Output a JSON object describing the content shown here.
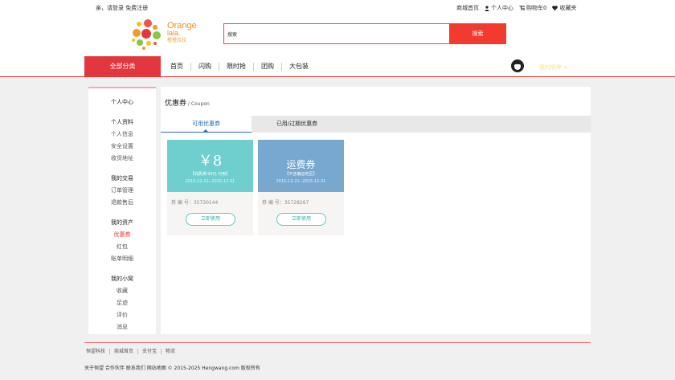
{
  "topbar": {
    "greeting": "亲，请登录 免费注册",
    "links": [
      "商城首页",
      "个人中心",
      "购物车0",
      "收藏夹"
    ]
  },
  "logo": {
    "line1": "Orange",
    "line2": "lala.",
    "line3": "橙橙拉拉"
  },
  "search": {
    "placeholder": "搜索",
    "button_label": "搜索"
  },
  "nav": {
    "category_label": "全部分类",
    "links": [
      "首页",
      "闪购",
      "限时抢",
      "团购",
      "大包装"
    ],
    "username": "我的昵称 ∨"
  },
  "sidebar": {
    "title": "个人中心",
    "groups": [
      {
        "label": "个人资料",
        "items": [
          "个人信息",
          "安全设置",
          "收货地址"
        ]
      },
      {
        "label": "我的交易",
        "items": [
          "订单管理",
          "退款售后"
        ]
      },
      {
        "label": "我的资产",
        "items": [
          "优惠券",
          "红包",
          "账单明细"
        ]
      },
      {
        "label": "我的小窝",
        "items": [
          "收藏",
          "足迹",
          "评价",
          "消息"
        ]
      }
    ]
  },
  "main": {
    "title": "优惠券",
    "subtitle": " / Coupon",
    "tabs": [
      "可用优惠券",
      "已用/过期优惠券"
    ],
    "coupons": [
      {
        "headline": "￥8",
        "condition": "【消费满 95元 可用】",
        "date": "2015-12-21--2015-12-31",
        "code": "券 编 号：35730144",
        "button": "立即使用",
        "color": "#6fcfce"
      },
      {
        "headline": "运费券",
        "condition": "【不含偏远地区】",
        "date": "2015-12-21--2015-12-31",
        "code": "券 编 号：35728267",
        "button": "立即使用",
        "color": "#78a7cf"
      }
    ]
  },
  "footer": {
    "links": [
      "恒望科技",
      "商城首页",
      "支付宝",
      "物流"
    ],
    "copyright": "关于恒望 合作伙伴 联系我们 网站地图 © 2015-2025 Hengwang.com 版权所有"
  },
  "colors": {
    "accent": "#e2373f",
    "search_button": "#f23a2e",
    "tab_active": "#2a6fb5"
  }
}
